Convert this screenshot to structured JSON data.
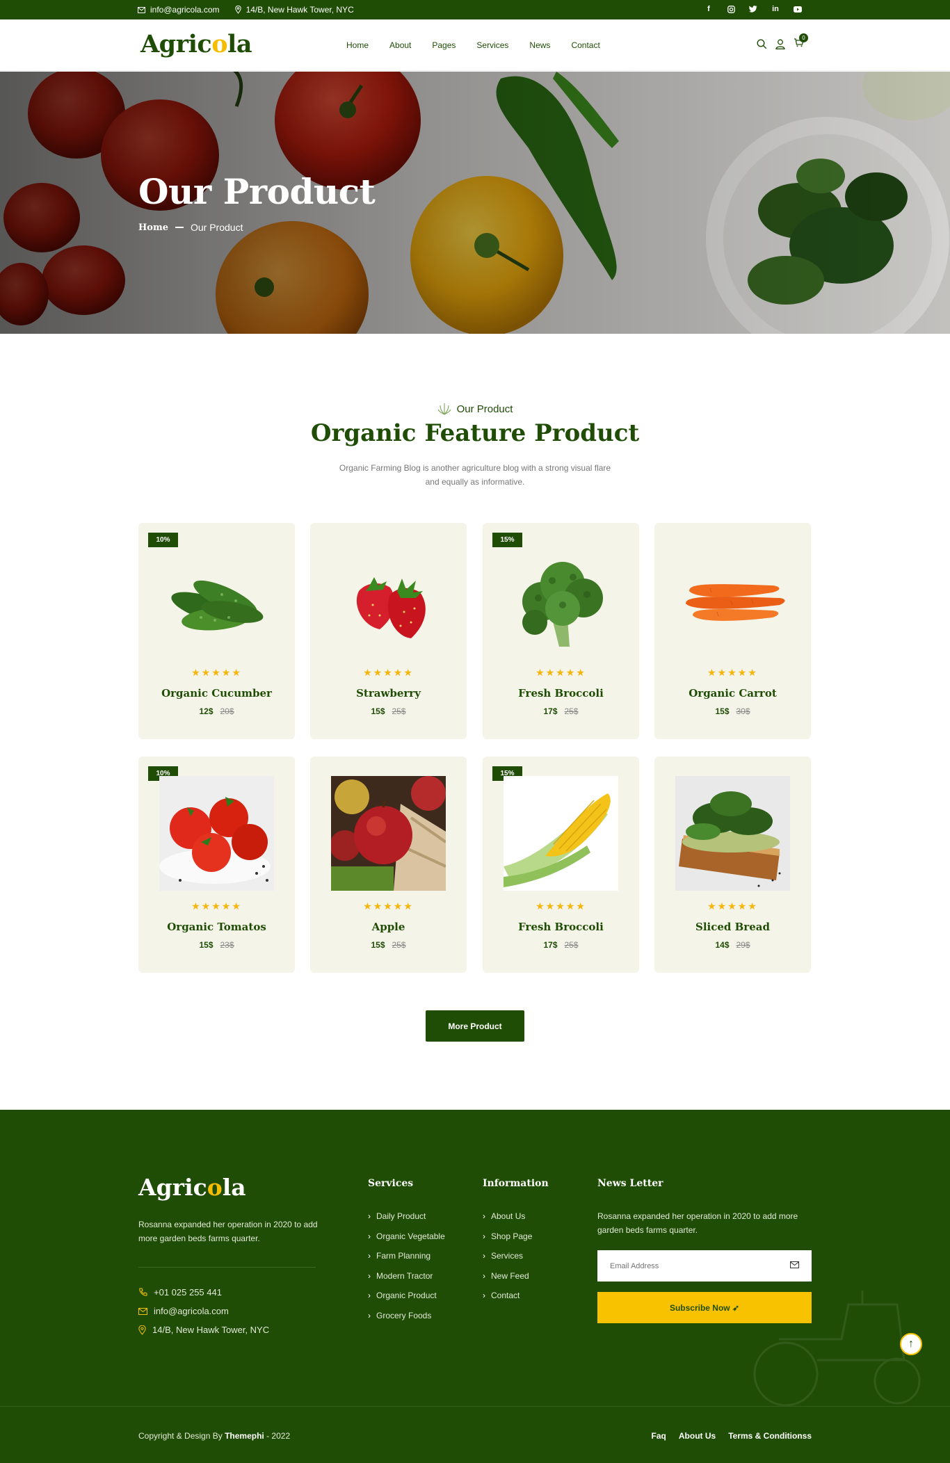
{
  "topbar": {
    "email": "info@agricola.com",
    "address": "14/B, New Hawk Tower, NYC",
    "social": [
      "facebook-icon",
      "instagram-icon",
      "twitter-icon",
      "linkedin-icon",
      "youtube-icon"
    ]
  },
  "header": {
    "logo_pre": "Agric",
    "logo_o": "o",
    "logo_post": "la",
    "nav": [
      "Home",
      "About",
      "Pages",
      "Services",
      "News",
      "Contact"
    ],
    "cart_count": "0"
  },
  "hero": {
    "title": "Our Product",
    "crumb_home": "Home",
    "crumb_current": "Our Product"
  },
  "section": {
    "tag": "Our Product",
    "title": "Organic Feature Product",
    "desc": "Organic Farming Blog is another agriculture blog with a strong visual flare and equally as informative."
  },
  "products": [
    {
      "name": "Organic Cucumber",
      "price": "12$",
      "old": "20$",
      "discount": "10%",
      "stars": "★★★★★"
    },
    {
      "name": "Strawberry",
      "price": "15$",
      "old": "25$",
      "discount": "",
      "stars": "★★★★★"
    },
    {
      "name": "Fresh Broccoli",
      "price": "17$",
      "old": "25$",
      "discount": "15%",
      "stars": "★★★★★"
    },
    {
      "name": "Organic Carrot",
      "price": "15$",
      "old": "30$",
      "discount": "",
      "stars": "★★★★★"
    },
    {
      "name": "Organic Tomatos",
      "price": "15$",
      "old": "23$",
      "discount": "10%",
      "stars": "★★★★★"
    },
    {
      "name": "Apple",
      "price": "15$",
      "old": "25$",
      "discount": "",
      "stars": "★★★★★"
    },
    {
      "name": "Fresh Broccoli",
      "price": "17$",
      "old": "25$",
      "discount": "15%",
      "stars": "★★★★★"
    },
    {
      "name": "Sliced Bread",
      "price": "14$",
      "old": "29$",
      "discount": "",
      "stars": "★★★★★"
    }
  ],
  "more_button": "More Product",
  "footer": {
    "desc": "Rosanna expanded her operation in 2020 to add more garden beds farms quarter.",
    "phone": "+01 025 255 441",
    "email": "info@agricola.com",
    "address": "14/B, New Hawk Tower, NYC",
    "services_title": "Services",
    "services": [
      "Daily Product",
      "Organic Vegetable",
      "Farm Planning",
      "Modern Tractor",
      "Organic Product",
      "Grocery Foods"
    ],
    "info_title": "Information",
    "info": [
      "About Us",
      "Shop Page",
      "Services",
      "New Feed",
      "Contact"
    ],
    "news_title": "News Letter",
    "news_desc": "Rosanna expanded her operation in 2020 to add more garden beds farms quarter.",
    "email_placeholder": "Email Address",
    "subscribe": "Subscribe Now",
    "copyright_pre": "Copyright & Design By",
    "copyright_brand": "Themephi",
    "copyright_year": "- 2022",
    "bottom_links": [
      "Faq",
      "About Us",
      "Terms & Conditionss"
    ]
  },
  "colors": {
    "primary": "#1f4d05",
    "accent": "#f8c200",
    "card": "#f5f4e8"
  }
}
